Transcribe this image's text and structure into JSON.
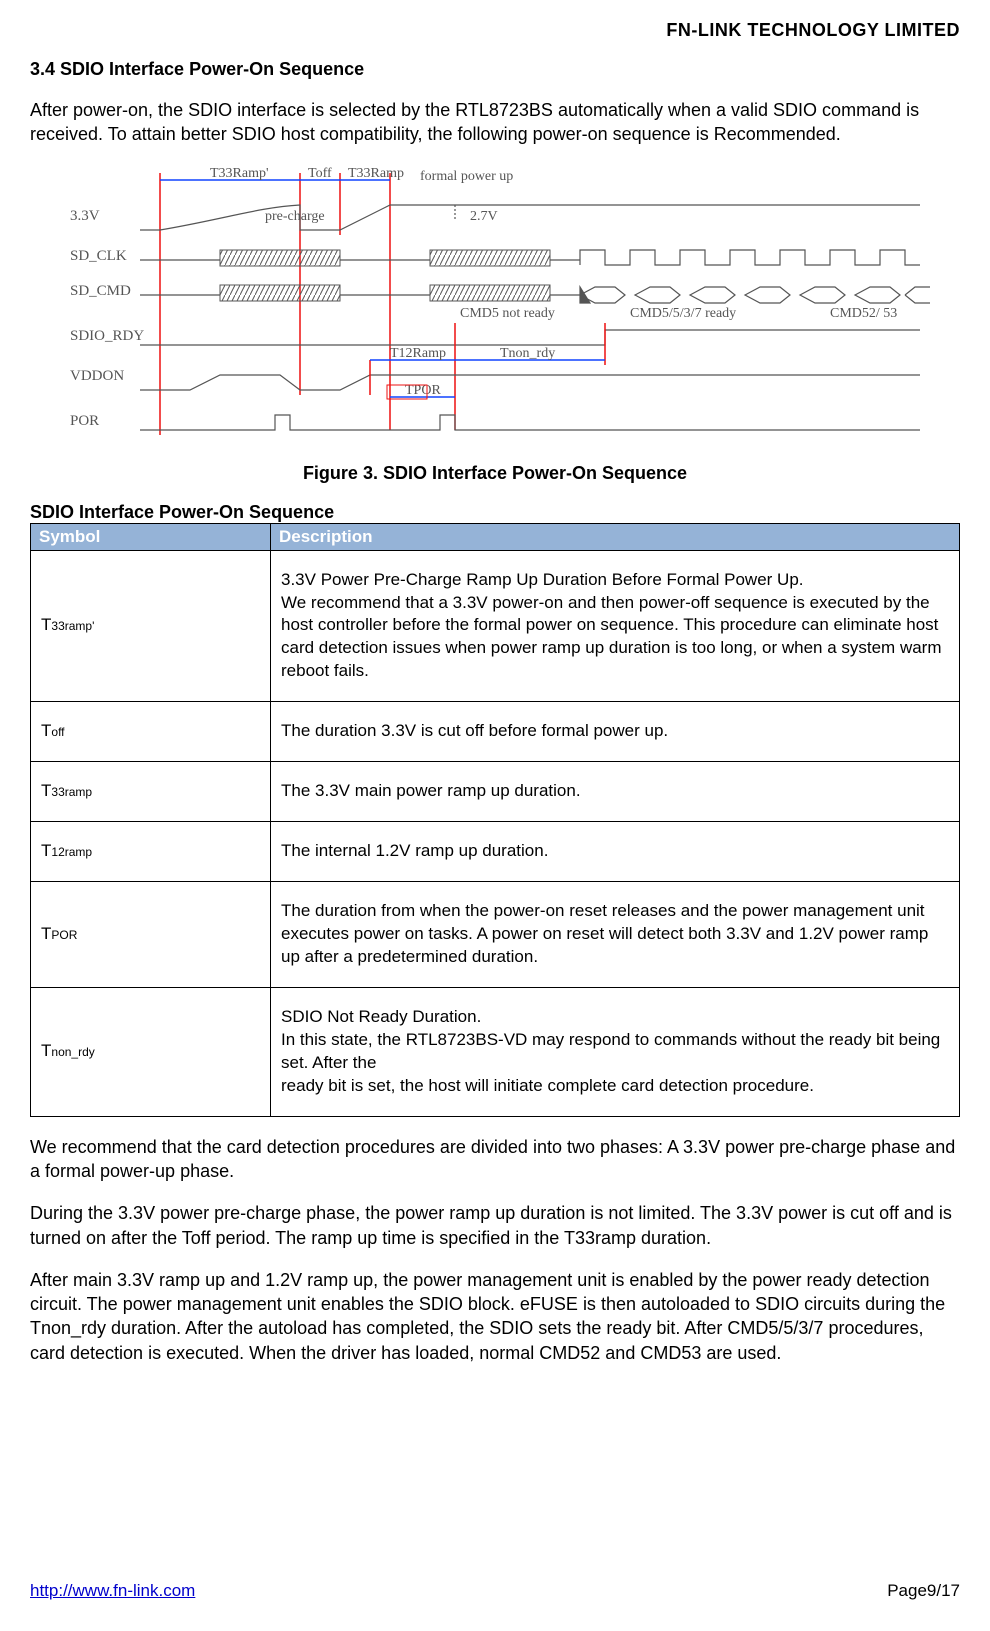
{
  "header": {
    "company": "FN-LINK  TECHNOLOGY  LIMITED"
  },
  "section_head": "3.4 SDIO Interface Power-On Sequence",
  "intro": "After power-on, the SDIO interface is selected by the RTL8723BS automatically when a valid SDIO command is received. To attain better SDIO host compatibility, the following power-on sequence is Recommended.",
  "figure": {
    "caption": "Figure 3. SDIO Interface Power-On Sequence",
    "signals": [
      "3.3V",
      "SD_CLK",
      "SD_CMD",
      "SDIO_RDY",
      "VDDON",
      "POR"
    ],
    "annotations": {
      "t33ramp_prime": "T33Ramp'",
      "toff": "Toff",
      "t33ramp": "T33Ramp",
      "t12ramp": "T12Ramp",
      "tnon_rdy": "Tnon_rdy",
      "tpor": "TPOR",
      "formal_power_up": "formal power up",
      "precharge": "pre-charge",
      "v27": "2.7V",
      "cmd5_not_ready": "CMD5 not ready",
      "cmd5_ready": "CMD5/5/3/7 ready",
      "cmd52": "CMD52/ 53"
    }
  },
  "table": {
    "heading": "SDIO Interface Power-On Sequence",
    "col_symbol": "Symbol",
    "col_desc": "Description",
    "rows": [
      {
        "symbol_main": "T",
        "symbol_sub": "33ramp'",
        "desc": "3.3V Power Pre-Charge Ramp Up Duration Before Formal Power Up.\nWe recommend that a 3.3V power-on and then power-off sequence is executed by the host controller before the formal power on sequence. This procedure can eliminate host card detection issues when power ramp up duration is too long, or when a system warm reboot fails."
      },
      {
        "symbol_main": "T",
        "symbol_sub": "off",
        "desc": "The duration 3.3V is cut off before formal power up."
      },
      {
        "symbol_main": "T",
        "symbol_sub": "33ramp",
        "desc": "The 3.3V main power ramp up duration."
      },
      {
        "symbol_main": "T",
        "symbol_sub": "12ramp",
        "desc": "The internal 1.2V ramp up duration."
      },
      {
        "symbol_main": "T",
        "symbol_sub": "POR",
        "desc": "The duration from when the power-on reset releases and the power management unit executes power on tasks. A power on reset will detect both 3.3V and 1.2V power ramp up after a predetermined duration."
      },
      {
        "symbol_main": "T",
        "symbol_sub": "non_rdy",
        "desc": "SDIO Not Ready Duration.\nIn this state, the RTL8723BS-VD may respond to commands without the ready bit being set. After the\nready bit is set, the host will initiate complete card detection procedure."
      }
    ]
  },
  "para1": "We recommend that the card detection procedures are divided into two phases: A 3.3V power pre-charge phase and a formal power-up phase.",
  "para2": "During the 3.3V power pre-charge phase, the power ramp up duration is not limited. The 3.3V power is cut off and is turned on after the Toff period. The ramp up time is specified in the T33ramp duration.",
  "para3": "After main 3.3V ramp up and 1.2V ramp up, the power management unit is enabled by the power ready detection circuit. The power management unit enables the SDIO block. eFUSE is then autoloaded to SDIO circuits during the Tnon_rdy duration. After the autoload has completed, the SDIO sets the ready bit. After CMD5/5/3/7 procedures, card detection is executed. When the driver has loaded, normal CMD52 and CMD53 are used.",
  "footer": {
    "url_text": "http://www.fn-link.com",
    "page": "Page9/17"
  }
}
